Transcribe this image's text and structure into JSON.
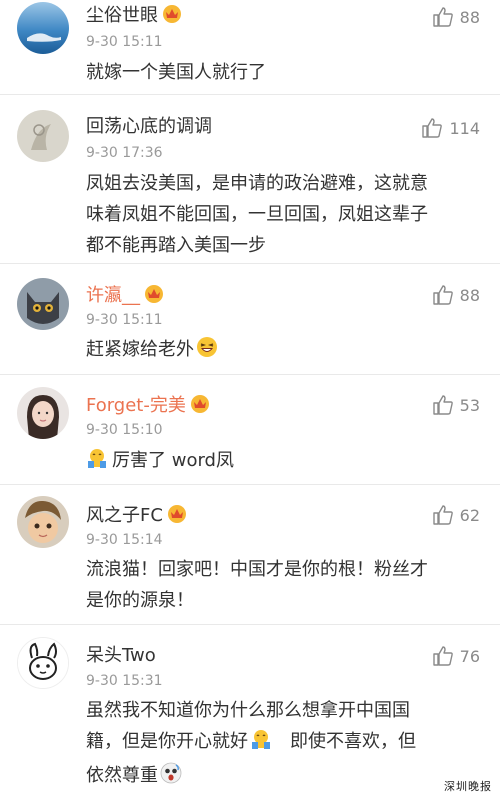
{
  "comments": [
    {
      "name": "尘俗世眼",
      "name_color": "#333333",
      "badge": "crown-icon",
      "time": "9-30 15:11",
      "likes": "88",
      "text": [
        "就嫁一个美国人就行了"
      ]
    },
    {
      "name": "回荡心底的调调",
      "name_color": "#333333",
      "badge": "",
      "time": "9-30 17:36",
      "likes": "114",
      "text": [
        "凤姐去没美国，是申请的政治避难，这就意",
        "味着凤姐不能回国，一旦回国，凤姐这辈子",
        "都不能再踏入美国一步"
      ]
    },
    {
      "name": "许瀛__",
      "name_color": "#eb7350",
      "badge": "crown-icon",
      "time": "9-30 15:11",
      "likes": "88",
      "text": [
        "赶紧嫁给老外"
      ],
      "emoji": "laughing-face-icon"
    },
    {
      "name": "Forget-完美",
      "name_color": "#eb7350",
      "badge": "crown-icon",
      "time": "9-30 15:10",
      "likes": "53",
      "text": [
        "厉害了 word凤"
      ],
      "emoji": "thumbs-up-face-icon"
    },
    {
      "name": "风之子FC",
      "name_color": "#333333",
      "badge": "crown-icon",
      "time": "9-30 15:14",
      "likes": "62",
      "text": [
        "流浪猫！回家吧！中国才是你的根！粉丝才",
        "是你的源泉！"
      ]
    },
    {
      "name": "呆头Two",
      "name_color": "#333333",
      "badge": "",
      "time": "9-30 15:31",
      "likes": "76",
      "text_a": "虽然我不知道你为什么那么想拿开中国国",
      "text_b1": "籍，但是你开心就好",
      "text_b2": "即使不喜欢，但",
      "text_c": "依然尊重"
    }
  ],
  "watermark": "深圳晚报"
}
